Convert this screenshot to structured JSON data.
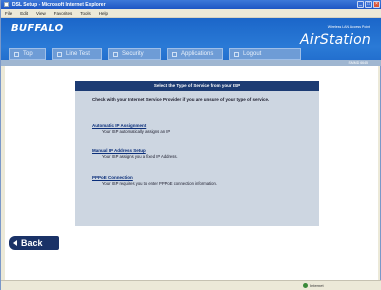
{
  "window": {
    "title": "DSL Setup - Microsoft Internet Explorer"
  },
  "menubar": {
    "items": [
      "File",
      "Edit",
      "View",
      "Favorites",
      "Tools",
      "Help"
    ]
  },
  "header": {
    "brand": "BUFFALO",
    "tagline": "Wireless LAN Access Point",
    "product": "AirStation",
    "model": "SMMD 6645"
  },
  "nav": {
    "tabs": [
      {
        "label": "Top"
      },
      {
        "label": "Line Test"
      },
      {
        "label": "Security"
      },
      {
        "label": "Applications"
      },
      {
        "label": "Logout"
      }
    ]
  },
  "panel": {
    "heading": "Select the Type of Service from your ISP",
    "intro": "Check with your Internet Service Provider if you are unsure of your type of service.",
    "options": [
      {
        "link": "Automatic IP Assignment",
        "desc": "Your ISP automatically assigns an IP"
      },
      {
        "link": "Manual IP Address Setup",
        "desc": "Your ISP assigns you a fixed IP Address."
      },
      {
        "link": "PPPoE Connection",
        "desc": "Your ISP requires you to enter PPPoE connection information."
      }
    ]
  },
  "back_button": {
    "label": "Back"
  },
  "statusbar": {
    "left": "",
    "zone": "Internet"
  }
}
